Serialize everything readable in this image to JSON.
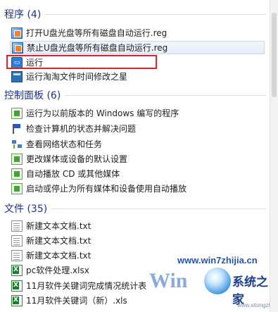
{
  "groups": {
    "programs": {
      "title": "程序 (4)",
      "items": [
        {
          "label": "打开U盘光盘等所有磁盘自动运行.reg",
          "icon": "registry-file-icon"
        },
        {
          "label": "禁止U盘光盘等所有磁盘自动运行.reg",
          "icon": "registry-file-icon"
        },
        {
          "label": "运行",
          "icon": "run-dialog-icon"
        },
        {
          "label": "运行淘淘文件时间修改之星",
          "icon": "application-icon"
        }
      ]
    },
    "control_panel": {
      "title": "控制面板 (6)",
      "items": [
        {
          "label": "运行为以前版本的 Windows 编写的程序",
          "icon": "control-panel-icon"
        },
        {
          "label": "检查计算机的状态并解决问题",
          "icon": "action-center-flag-icon"
        },
        {
          "label": "查看网络状态和任务",
          "icon": "network-icon"
        },
        {
          "label": "更改媒体或设备的默认设置",
          "icon": "control-panel-icon"
        },
        {
          "label": "自动播放 CD 或其他媒体",
          "icon": "control-panel-icon"
        },
        {
          "label": "启动或停止为所有媒体和设备使用自动播放",
          "icon": "control-panel-icon"
        }
      ]
    },
    "files": {
      "title": "文件 (35)",
      "items": [
        {
          "label": "新建文本文档.txt",
          "icon": "text-file-icon"
        },
        {
          "label": "新建文本文档.txt",
          "icon": "text-file-icon"
        },
        {
          "label": "新建文本文档.txt",
          "icon": "text-file-icon"
        },
        {
          "label": "pc软件处理.xlsx",
          "icon": "excel-file-icon"
        },
        {
          "label": "11月软件关键词完成情况统计表",
          "icon": "excel-file-icon"
        },
        {
          "label": "11月软件关键词（新）.xls",
          "icon": "excel-file-icon"
        }
      ]
    }
  },
  "watermark": {
    "url": "www.win7zhijia.cn",
    "brand": "系统之家",
    "url_small": "www.xitongzhijia.net"
  },
  "colors": {
    "group_title": "#1e3287",
    "highlight_box": "#e0202a"
  }
}
